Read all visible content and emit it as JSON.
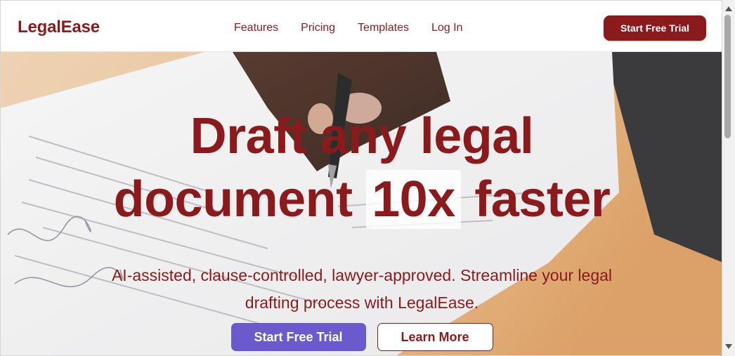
{
  "header": {
    "brand": "LegalEase",
    "nav": [
      "Features",
      "Pricing",
      "Templates",
      "Log In"
    ],
    "cta_label": "Start Free Trial"
  },
  "hero": {
    "headline_line1": "Draft any legal",
    "headline_pre": "document",
    "headline_highlight": "10x",
    "headline_post": "faster",
    "subheadline": "AI-assisted, clause-controlled, lawyer-approved. Streamline your legal drafting process with LegalEase.",
    "primary_label": "Start Free Trial",
    "secondary_label": "Learn More",
    "background_image": "hand-signing-document-photo"
  },
  "colors": {
    "brand": "#8b1a1d",
    "primary_button": "#6a5acd",
    "white": "#ffffff"
  },
  "scrollbar": {
    "up_icon": "scroll-up-arrow-icon",
    "down_icon": "scroll-down-arrow-icon"
  }
}
